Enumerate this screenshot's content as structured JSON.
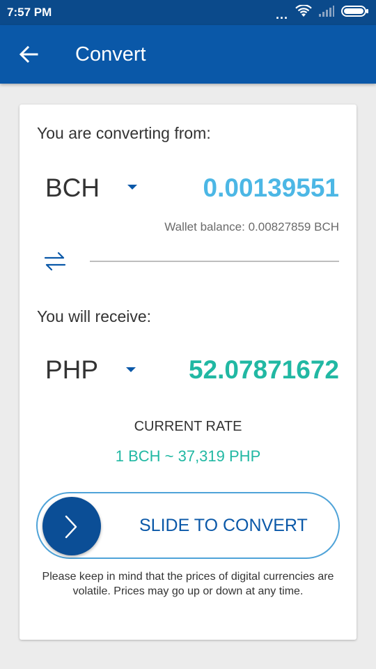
{
  "status_bar": {
    "time": "7:57 PM",
    "dots": "..."
  },
  "app_bar": {
    "title": "Convert"
  },
  "from": {
    "label": "You are converting from:",
    "currency": "BCH",
    "amount": "0.00139551",
    "wallet_balance": "Wallet balance: 0.00827859 BCH"
  },
  "to": {
    "label": "You will receive:",
    "currency": "PHP",
    "amount": "52.07871672"
  },
  "rate": {
    "title": "CURRENT RATE",
    "value": "1 BCH ~ 37,319 PHP"
  },
  "slider": {
    "label": "SLIDE TO CONVERT"
  },
  "note": "Please keep in mind that the prices of digital currencies are volatile. Prices may go up or down at any time.",
  "colors": {
    "status_bar": "#0b4a8b",
    "app_bar": "#0a58a8",
    "from_amount": "#4cb7e5",
    "to_amount": "#21b8a3",
    "knob": "#0b4e96"
  },
  "icons": [
    "back-arrow-icon",
    "wifi-icon",
    "signal-icon",
    "battery-icon",
    "swap-icon",
    "chevron-right-icon"
  ]
}
